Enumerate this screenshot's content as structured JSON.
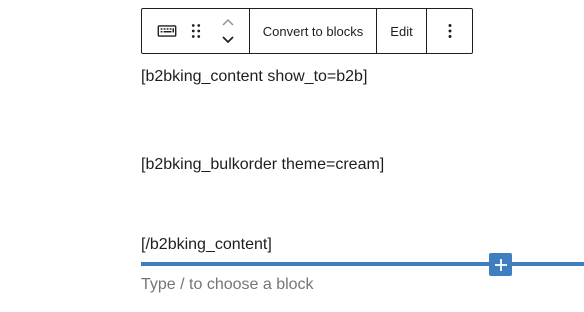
{
  "toolbar": {
    "block_type_icon": "keyboard-icon",
    "drag_icon": "drag-handle-icon",
    "move_up_icon": "chevron-up-icon",
    "move_down_icon": "chevron-down-icon",
    "convert_label": "Convert to blocks",
    "edit_label": "Edit",
    "more_icon": "more-vertical-icon"
  },
  "content": {
    "paragraphs": [
      "[b2bking_content show_to=b2b]",
      "[b2bking_bulkorder theme=cream]",
      "[/b2bking_content]"
    ]
  },
  "inserter": {
    "icon": "plus-icon",
    "color": "#3f7fbf"
  },
  "appender": {
    "placeholder": "Type / to choose a block"
  }
}
